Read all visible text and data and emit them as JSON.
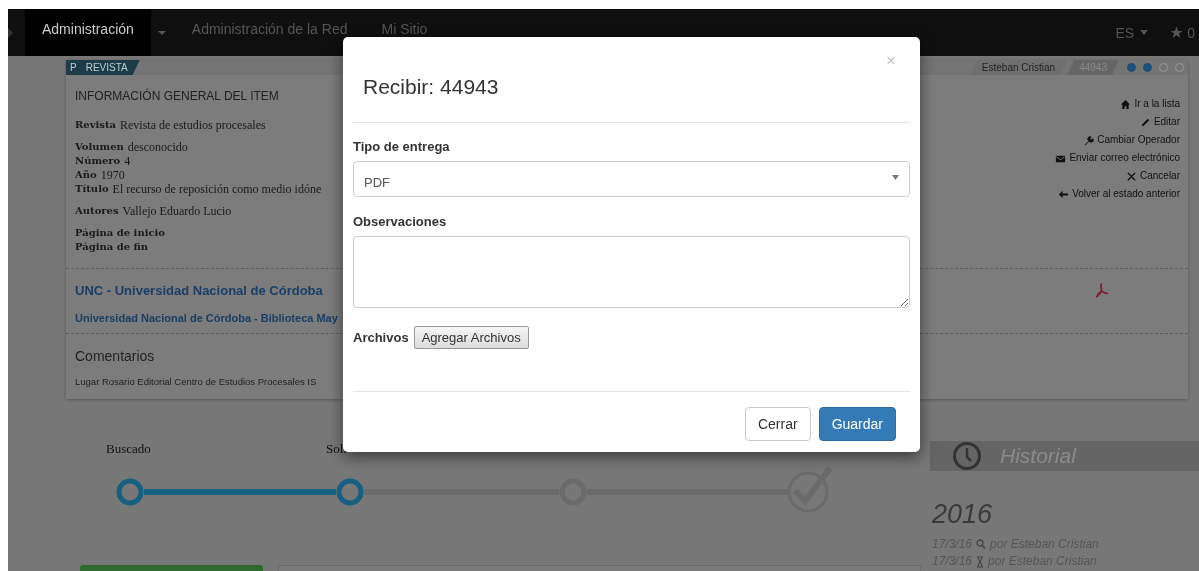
{
  "navbar": {
    "items": [
      {
        "label": "Administración",
        "selected": true,
        "kind": "link"
      },
      {
        "kind": "caret"
      },
      {
        "label": "Administración de la Red",
        "selected": false,
        "kind": "link"
      },
      {
        "label": "Mi Sitio",
        "selected": false,
        "kind": "link"
      }
    ],
    "language": "ES",
    "favorites": "0"
  },
  "item": {
    "badge_letter": "P",
    "badge_type": "REVISTA",
    "operator": "Esteban Cristian",
    "number": "44943",
    "progress": [
      {
        "filled": true
      },
      {
        "filled": true
      },
      {
        "filled": false
      },
      {
        "filled": false
      }
    ],
    "section_title": "INFORMACIÓN GENERAL DEL ITEM",
    "fields": [
      {
        "label": "Revista",
        "value": "Revista de estudios procesales"
      },
      {
        "label": "Volumen",
        "value": "desconocido"
      },
      {
        "label": "Número",
        "value": "4"
      },
      {
        "label": "Año",
        "value": "1970"
      },
      {
        "label": "Título",
        "value": "El recurso de reposición como medio idóne"
      },
      {
        "label": "Autores",
        "value": "Vallejo Eduardo Lucio"
      },
      {
        "label": "Página de inicio"
      },
      {
        "label": "Página de fin"
      }
    ],
    "actions": [
      {
        "label": "Ir a la lista"
      },
      {
        "label": "Editar"
      },
      {
        "label": "Cambiar Operador"
      },
      {
        "label": "Enviar correo electrónico"
      },
      {
        "label": "Cancelar"
      },
      {
        "label": "Volver al estado anterior"
      }
    ],
    "library": {
      "name": "UNC - Universidad Nacional de Córdoba",
      "branch": "Universidad Nacional de Córdoba - Biblioteca May"
    },
    "comments_title": "Comentarios",
    "details": "Lugar Rosario  Editorial Centro de Estudios Procesales  IS"
  },
  "steps": [
    {
      "label": "Buscado",
      "done": true,
      "kind": "circle"
    },
    {
      "label": "Soli",
      "done": true,
      "kind": "circle"
    },
    {
      "done": false,
      "kind": "circle"
    },
    {
      "done": false,
      "kind": "check"
    }
  ],
  "history": {
    "title": "Historial",
    "year": "2016",
    "entries": [
      {
        "date": "17/3/16",
        "text": "por Esteban Cristian"
      },
      {
        "date": "17/3/16",
        "text": "por Esteban Cristian"
      }
    ]
  },
  "modal": {
    "title": "Recibir: 44943",
    "close": "×",
    "delivery_label": "Tipo de entrega",
    "delivery_value": "PDF",
    "notes_label": "Observaciones",
    "files_label": "Archivos",
    "add_files": "Agregar Archivos",
    "cancel": "Cerrar",
    "save": "Guardar"
  }
}
